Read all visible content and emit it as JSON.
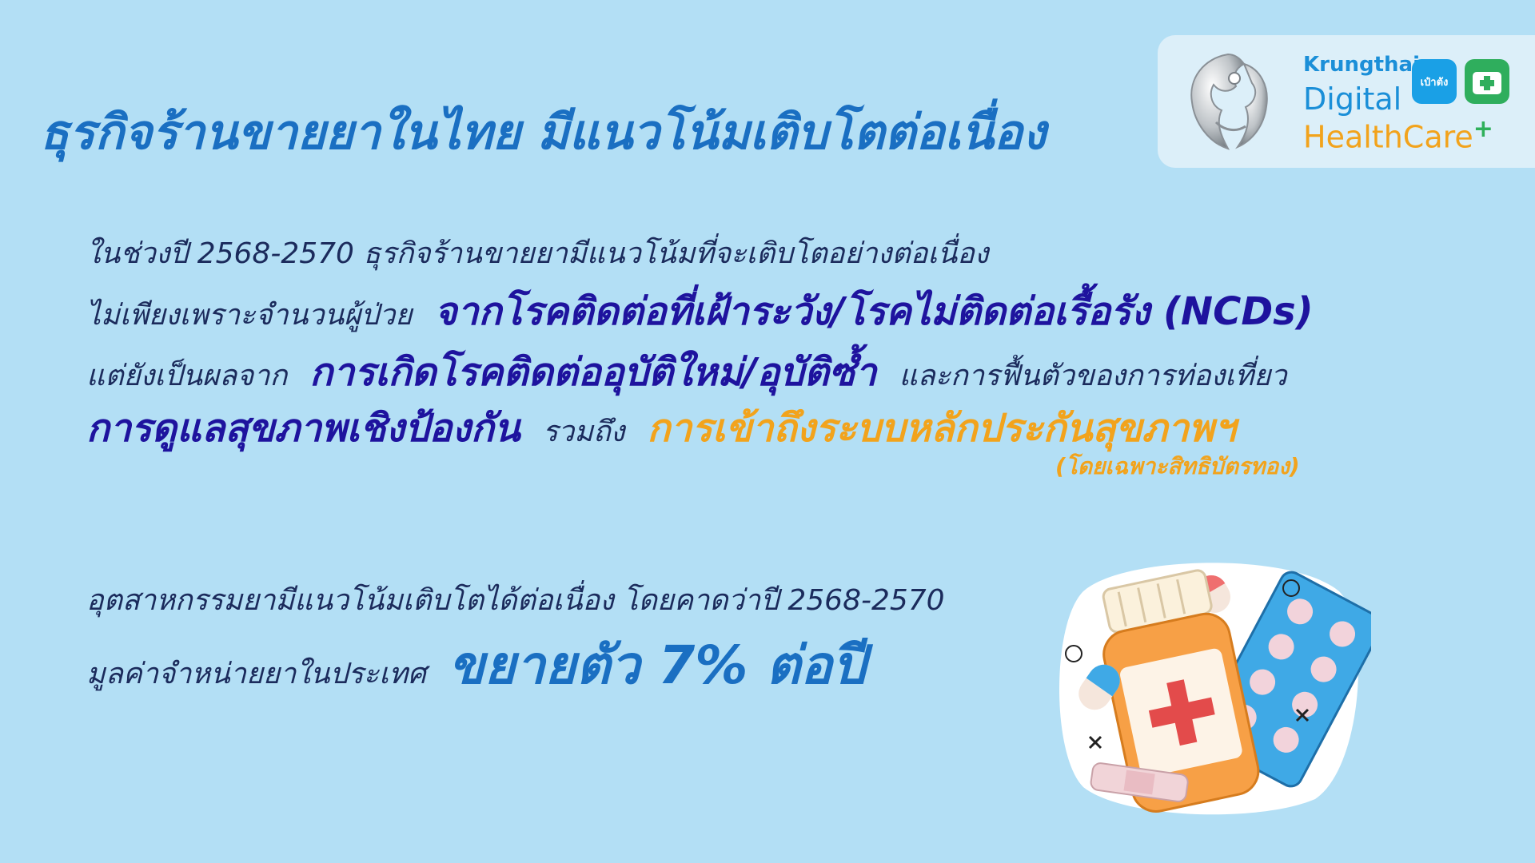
{
  "title": "ธุรกิจร้านขายยาในไทย มีแนวโน้มเติบโตต่อเนื่อง",
  "logo": {
    "brand_top": "Krungthai",
    "brand_mid": "Digital",
    "brand_bottom": "HealthCare",
    "brand_plus": "+",
    "paotang_label": "เป๋าตัง",
    "health_icon": "first-aid-icon"
  },
  "para1": {
    "line1": "ในช่วงปี 2568-2570 ธุรกิจร้านขายยามีแนวโน้มที่จะเติบโตอย่างต่อเนื่อง",
    "line2_a": "ไม่เพียงเพราะจำนวนผู้ป่วย",
    "line2_b": "จากโรคติดต่อที่เฝ้าระวัง/โรคไม่ติดต่อเรื้อรัง (NCDs)",
    "line3_a": "แต่ยังเป็นผลจาก",
    "line3_b": "การเกิดโรคติดต่ออุบัติใหม่/อุบัติซ้ำ",
    "line3_c": "และการฟื้นตัวของการท่องเที่ยว",
    "line4_a": "การดูแลสุขภาพเชิงป้องกัน",
    "line4_b": "รวมถึง",
    "line4_c": "การเข้าถึงระบบหลักประกันสุขภาพฯ",
    "line5": "(โดยเฉพาะสิทธิบัตรทอง)"
  },
  "para2": {
    "line1": "อุตสาหกรรมยามีแนวโน้มเติบโตได้ต่อเนื่อง โดยคาดว่าปี 2568-2570",
    "line2_a": "มูลค่าจำหน่ายยาในประเทศ",
    "line2_b": "ขยายตัว 7% ต่อปี"
  },
  "illustration": {
    "icon": "medicine-bottle-and-pills-icon"
  },
  "colors": {
    "background": "#b3dff5",
    "title": "#1a6fc2",
    "highlight": "#1e139e",
    "gold": "#f2a31c",
    "body": "#1b2b5c"
  }
}
